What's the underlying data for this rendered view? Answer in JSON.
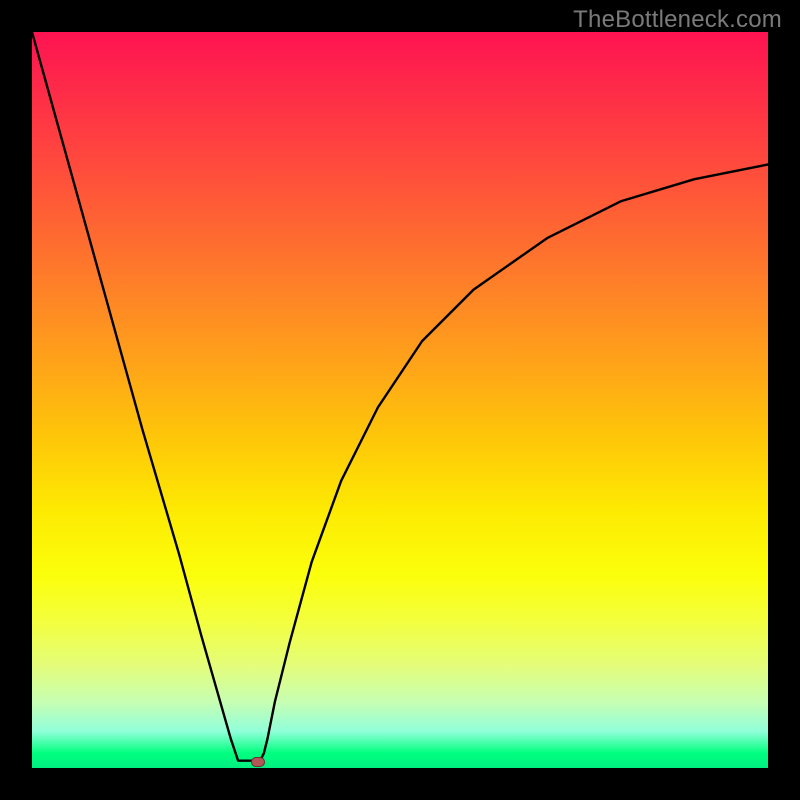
{
  "watermark": "TheBottleneck.com",
  "colors": {
    "frame": "#000000",
    "gradient_top": "#fe1351",
    "gradient_bottom": "#00ee80",
    "curve": "#000000",
    "marker": "#b25758"
  },
  "chart_data": {
    "type": "line",
    "title": "",
    "xlabel": "",
    "ylabel": "",
    "xlim": [
      0,
      1
    ],
    "ylim": [
      0,
      1
    ],
    "x": [
      0.0,
      0.05,
      0.1,
      0.15,
      0.2,
      0.23,
      0.27,
      0.28,
      0.3,
      0.305,
      0.31,
      0.315,
      0.32,
      0.33,
      0.35,
      0.38,
      0.42,
      0.47,
      0.53,
      0.6,
      0.7,
      0.8,
      0.9,
      1.0
    ],
    "y": [
      1.0,
      0.82,
      0.64,
      0.46,
      0.29,
      0.18,
      0.04,
      0.01,
      0.01,
      0.01,
      0.01,
      0.02,
      0.04,
      0.09,
      0.17,
      0.28,
      0.39,
      0.49,
      0.58,
      0.65,
      0.72,
      0.77,
      0.8,
      0.82
    ],
    "series": [
      {
        "name": "bottleneck-curve",
        "x_key": "x",
        "y_key": "y"
      }
    ],
    "marker": {
      "x": 0.307,
      "y": 0.008
    },
    "legend": false,
    "grid": false
  }
}
